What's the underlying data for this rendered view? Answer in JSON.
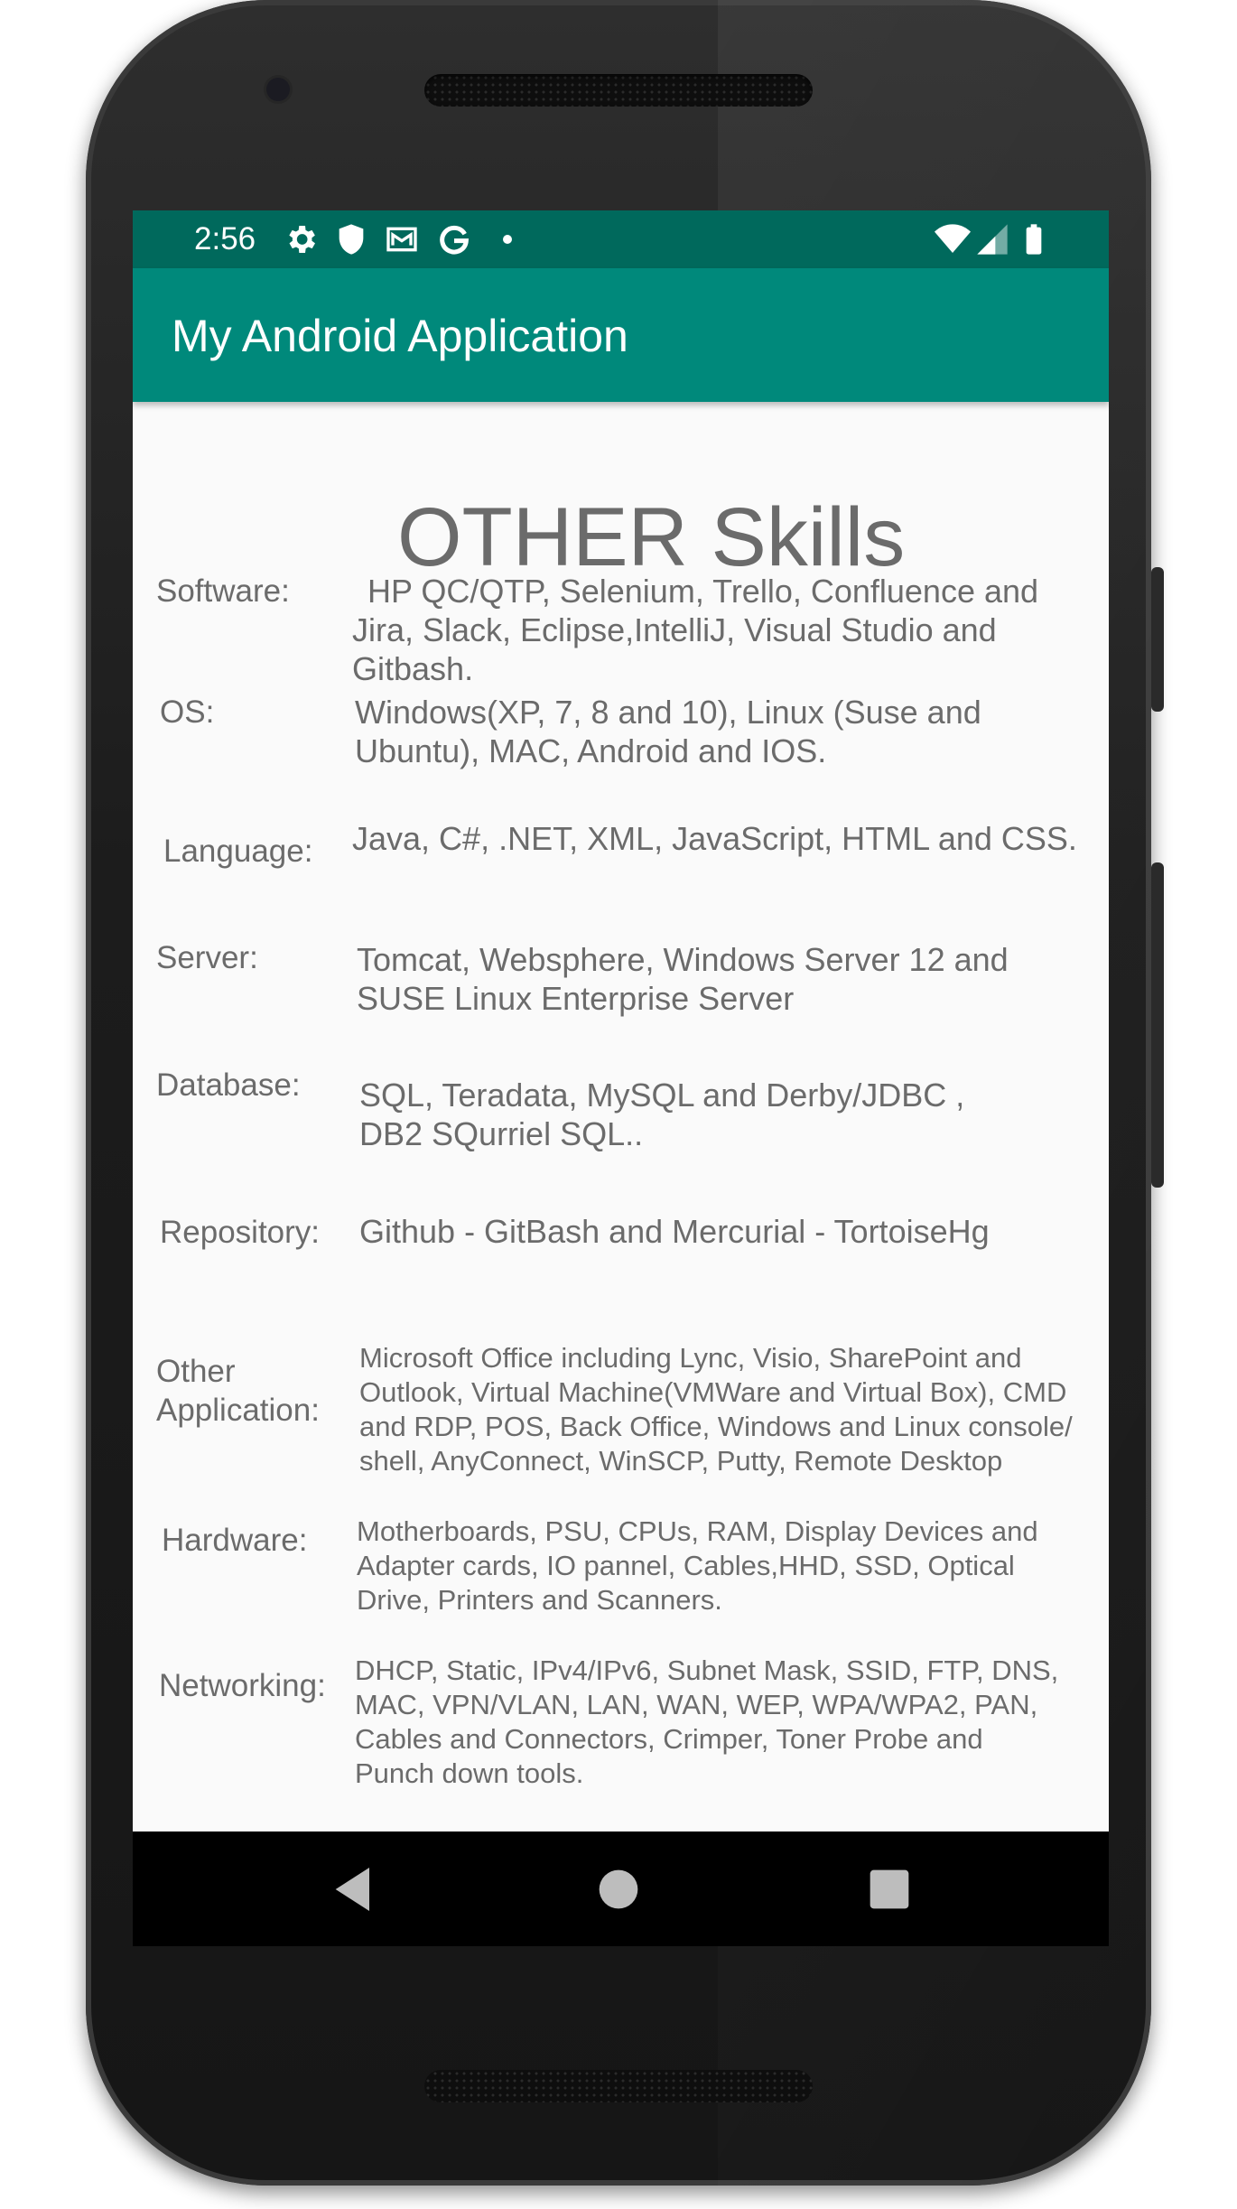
{
  "status_bar": {
    "time": "2:56",
    "icons": [
      "gear-icon",
      "shield-icon",
      "mail-icon",
      "google-icon",
      "dot-icon",
      "wifi-icon",
      "signal-icon",
      "battery-icon"
    ]
  },
  "app_bar": {
    "title": "My Android Application"
  },
  "page": {
    "title": "OTHER Skills",
    "rows": [
      {
        "label": "Software:",
        "value": "HP QC/QTP, Selenium, Trello, Confluence and Jira, Slack, Eclipse,IntelliJ, Visual Studio and Gitbash."
      },
      {
        "label": "OS:",
        "value": "Windows(XP, 7, 8 and 10), Linux (Suse and Ubuntu), MAC, Android and IOS."
      },
      {
        "label": "Language:",
        "value": "Java, C#, .NET, XML, JavaScript, HTML and CSS."
      },
      {
        "label": "Server:",
        "value": "Tomcat, Websphere, Windows Server 12 and SUSE Linux Enterprise Server"
      },
      {
        "label": "Database:",
        "value": "SQL, Teradata, MySQL and Derby/JDBC , DB2 SQurriel SQL.."
      },
      {
        "label": "Repository:",
        "value": "Github - GitBash and Mercurial - TortoiseHg"
      },
      {
        "label": "Other Application:",
        "value": "Microsoft Office including Lync, Visio, SharePoint and Outlook, Virtual Machine(VMWare and Virtual Box), CMD and RDP, POS, Back Office, Windows and Linux console/ shell, AnyConnect, WinSCP, Putty, Remote Desktop"
      },
      {
        "label": "Hardware:",
        "value": "Motherboards, PSU, CPUs, RAM, Display Devices and Adapter cards, IO pannel, Cables,HHD, SSD, Optical Drive, Printers and Scanners."
      },
      {
        "label": "Networking:",
        "value": "DHCP, Static, IPv4/IPv6, Subnet Mask, SSID, FTP, DNS, MAC, VPN/VLAN, LAN, WAN, WEP, WPA/WPA2, PAN, Cables and Connectors, Crimper, Toner Probe and Punch down tools."
      }
    ]
  },
  "nav_bar": {
    "buttons": [
      "back-icon",
      "home-icon",
      "recents-icon"
    ]
  },
  "colors": {
    "status_bar": "#00695c",
    "app_bar": "#00897b",
    "text": "#6b6b6b",
    "background": "#fafafa"
  }
}
